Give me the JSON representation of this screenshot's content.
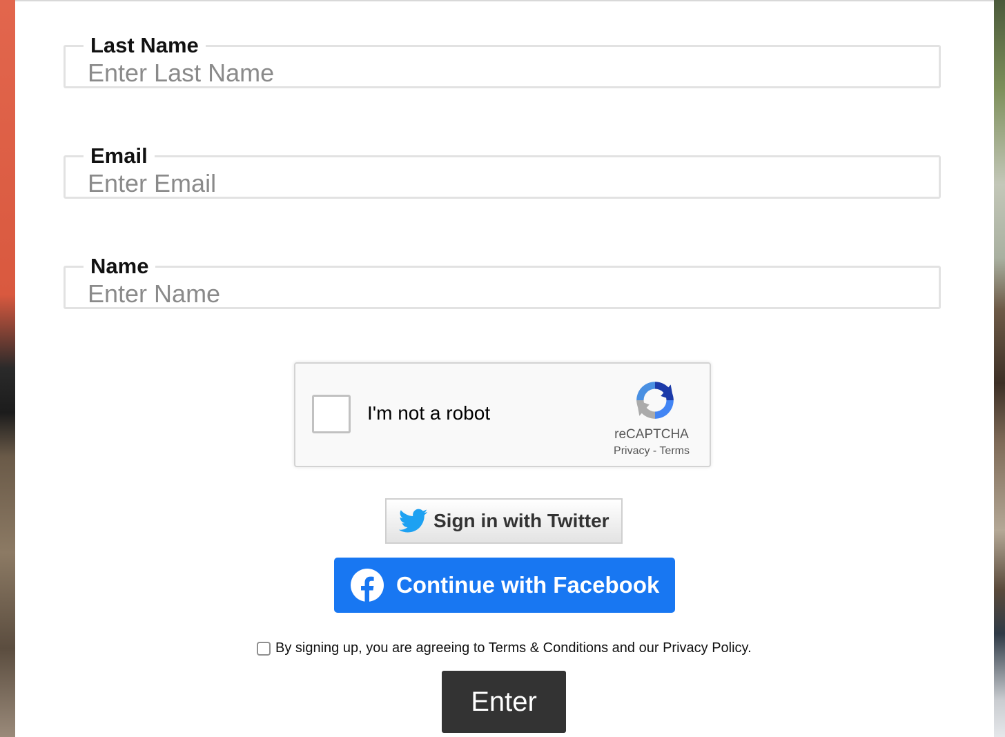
{
  "fields": [
    {
      "legend": "Last Name",
      "placeholder": "Enter Last Name"
    },
    {
      "legend": "Email",
      "placeholder": "Enter Email"
    },
    {
      "legend": "Name",
      "placeholder": "Enter Name"
    }
  ],
  "recaptcha": {
    "label": "I'm not a robot",
    "brand": "reCAPTCHA",
    "links": "Privacy - Terms"
  },
  "social": {
    "twitter_label": "Sign in with Twitter",
    "facebook_label": "Continue with Facebook",
    "twitter_color": "#1da1f2",
    "facebook_color": "#1877f2"
  },
  "terms": {
    "text": "By signing up, you are agreeing to Terms & Conditions and our Privacy Policy."
  },
  "submit": {
    "label": "Enter"
  }
}
